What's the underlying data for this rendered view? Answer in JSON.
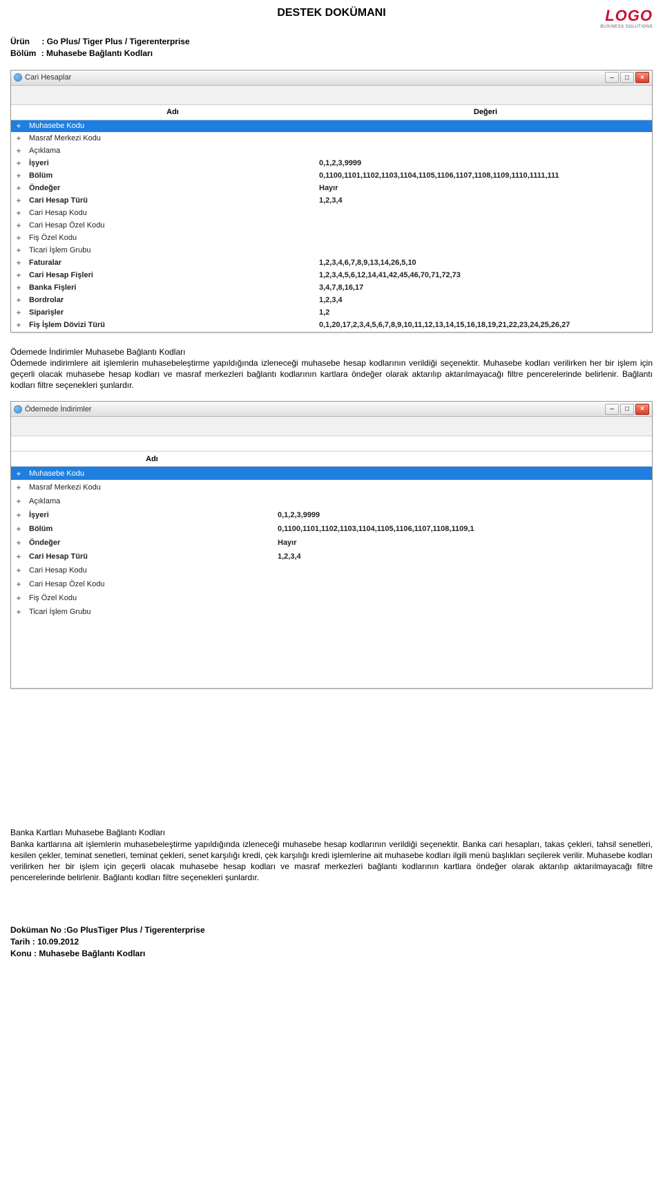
{
  "doc": {
    "title": "DESTEK DOKÜMANI",
    "urun_label": "Ürün",
    "bolum_label": "Bölüm",
    "urun_value": ": Go Plus/ Tiger Plus / Tigerenterprise",
    "bolum_value": ": Muhasebe Bağlantı Kodları"
  },
  "logo": {
    "brand": "LOGO",
    "tagline": "BUSINESS SOLUTIONS"
  },
  "window1": {
    "title": "Cari Hesaplar",
    "head_name": "Adı",
    "head_value": "Değeri",
    "rows": [
      {
        "name": "Muhasebe Kodu",
        "value": "",
        "selected": true
      },
      {
        "name": "Masraf Merkezi Kodu",
        "value": ""
      },
      {
        "name": "Açıklama",
        "value": ""
      },
      {
        "name": "İşyeri",
        "value": "0,1,2,3,9999",
        "bold": true
      },
      {
        "name": "Bölüm",
        "value": "0,1100,1101,1102,1103,1104,1105,1106,1107,1108,1109,1110,1111,111",
        "bold": true
      },
      {
        "name": "Öndeğer",
        "value": "Hayır",
        "bold": true
      },
      {
        "name": "Cari Hesap Türü",
        "value": "1,2,3,4",
        "bold": true
      },
      {
        "name": "Cari Hesap Kodu",
        "value": ""
      },
      {
        "name": "Cari Hesap Özel Kodu",
        "value": ""
      },
      {
        "name": "Fiş Özel Kodu",
        "value": ""
      },
      {
        "name": "Ticari İşlem Grubu",
        "value": ""
      },
      {
        "name": "Faturalar",
        "value": "1,2,3,4,6,7,8,9,13,14,26,5,10",
        "bold": true
      },
      {
        "name": "Cari Hesap Fişleri",
        "value": "1,2,3,4,5,6,12,14,41,42,45,46,70,71,72,73",
        "bold": true
      },
      {
        "name": "Banka Fişleri",
        "value": "3,4,7,8,16,17",
        "bold": true
      },
      {
        "name": "Bordrolar",
        "value": "1,2,3,4",
        "bold": true
      },
      {
        "name": "Siparişler",
        "value": "1,2",
        "bold": true
      },
      {
        "name": "Fiş İşlem Dövizi Türü",
        "value": "0,1,20,17,2,3,4,5,6,7,8,9,10,11,12,13,14,15,16,18,19,21,22,23,24,25,26,27",
        "bold": true
      }
    ]
  },
  "section1": {
    "heading": "Ödemede İndirimler Muhasebe Bağlantı Kodları",
    "text": "Ödemede indirimlere ait işlemlerin muhasebeleştirme yapıldığında izleneceği muhasebe hesap kodlarının verildiği seçenektir. Muhasebe kodları verilirken her bir işlem için geçerli olacak muhasebe hesap kodları ve masraf merkezleri bağlantı kodlarının kartlara öndeğer olarak aktarılıp aktarılmayacağı filtre pencerelerinde belirlenir. Bağlantı kodları filtre seçenekleri şunlardır."
  },
  "window2": {
    "title": "Ödemede İndirimler",
    "head_name": "Adı",
    "head_value": "",
    "rows": [
      {
        "name": "Muhasebe Kodu",
        "value": "",
        "selected": true
      },
      {
        "name": "Masraf Merkezi Kodu",
        "value": ""
      },
      {
        "name": "Açıklama",
        "value": ""
      },
      {
        "name": "İşyeri",
        "value": "0,1,2,3,9999",
        "bold": true
      },
      {
        "name": "Bölüm",
        "value": "0,1100,1101,1102,1103,1104,1105,1106,1107,1108,1109,1",
        "bold": true
      },
      {
        "name": "Öndeğer",
        "value": "Hayır",
        "bold": true
      },
      {
        "name": "Cari Hesap Türü",
        "value": "1,2,3,4",
        "bold": true
      },
      {
        "name": "Cari Hesap Kodu",
        "value": ""
      },
      {
        "name": "Cari Hesap Özel Kodu",
        "value": ""
      },
      {
        "name": "Fiş Özel Kodu",
        "value": ""
      },
      {
        "name": "Ticari İşlem Grubu",
        "value": ""
      }
    ]
  },
  "section2": {
    "heading": "Banka Kartları Muhasebe Bağlantı Kodları",
    "text": "Banka kartlarına ait işlemlerin muhasebeleştirme yapıldığında izleneceği muhasebe hesap kodlarının verildiği seçenektir. Banka cari hesapları, takas çekleri, tahsil senetleri, kesilen çekler, teminat senetleri, teminat çekleri, senet karşılığı kredi, çek karşılığı kredi işlemlerine ait muhasebe kodları ilgili menü başlıkları seçilerek verilir. Muhasebe kodları verilirken her bir işlem için geçerli olacak muhasebe hesap kodları ve masraf merkezleri bağlantı kodlarının kartlara öndeğer olarak aktarılıp aktarılmayacağı filtre pencerelerinde belirlenir. Bağlantı kodları filtre seçenekleri şunlardır."
  },
  "footer": {
    "l1_label": "Doküman No :",
    "l1_value": "Go PlusTiger Plus / Tigerenterprise",
    "l2_label": "Tarih : ",
    "l2_value": "10.09.2012",
    "l3_label": "Konu : ",
    "l3_value": "Muhasebe Bağlantı Kodları"
  },
  "glyphs": {
    "plus": "+",
    "min": "–",
    "max": "□",
    "close": "×"
  }
}
